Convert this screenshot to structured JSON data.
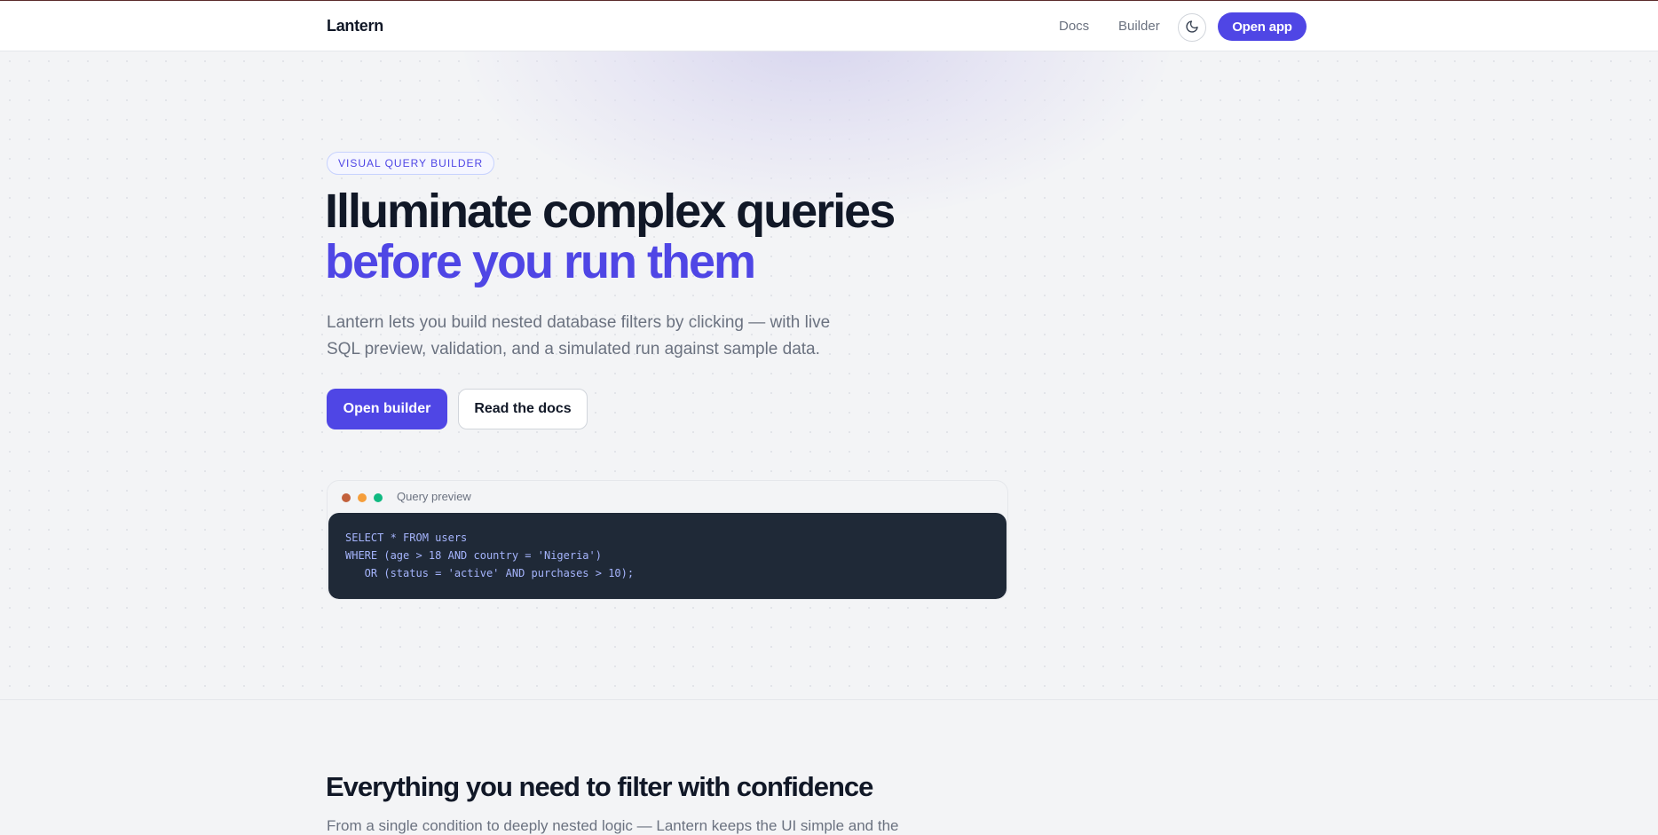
{
  "header": {
    "brand": "Lantern",
    "nav": {
      "docs": "Docs",
      "builder": "Builder"
    },
    "theme_toggle_icon": "moon-icon",
    "open_app_label": "Open app"
  },
  "hero": {
    "badge": "VISUAL QUERY BUILDER",
    "headline_line1": "Illuminate complex queries",
    "headline_line2": "before you run them",
    "subtitle": "Lantern lets you build nested database filters by clicking — with live SQL preview, validation, and a simulated run against sample data.",
    "primary_cta": "Open builder",
    "secondary_cta": "Read the docs"
  },
  "preview": {
    "title": "Query preview",
    "code": "SELECT * FROM users\nWHERE (age > 18 AND country = 'Nigeria')\n   OR (status = 'active' AND purchases > 10);"
  },
  "features": {
    "title": "Everything you need to filter with confidence",
    "subtitle": "From a single condition to deeply nested logic — Lantern keeps the UI simple and the"
  },
  "colors": {
    "accent": "#4f46e5",
    "dark_text": "#111827",
    "muted_text": "#6b7280",
    "code_background": "#1f2937",
    "dot_red": "#c2603b",
    "dot_orange": "#f59e3b",
    "dot_green": "#10b981"
  }
}
